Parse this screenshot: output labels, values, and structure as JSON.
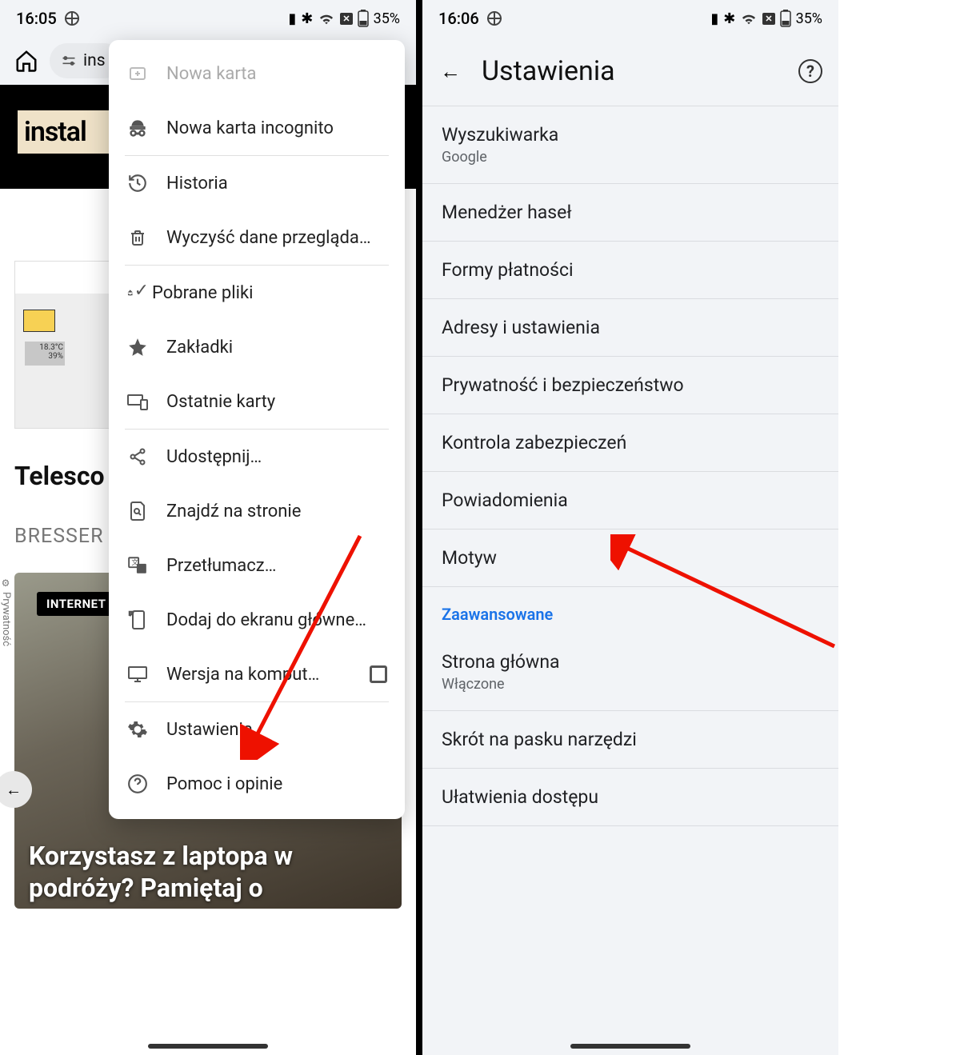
{
  "screen1": {
    "status": {
      "time": "16:05",
      "battery": "35%"
    },
    "address_text": "ins",
    "page": {
      "logo": "instal",
      "lcd_top": "18.3°C",
      "lcd_bot": "39%",
      "article_title": "Telesco",
      "brand": "BRESSER",
      "tag": "INTERNET",
      "headline": "Korzystasz z laptopa w podróży? Pamiętaj o",
      "priv_label": "Prywatność"
    },
    "menu": {
      "new_tab": "Nowa karta",
      "incognito": "Nowa karta incognito",
      "history": "Historia",
      "clear_data": "Wyczyść dane przegląda…",
      "downloads": "Pobrane pliki",
      "bookmarks": "Zakładki",
      "recent_tabs": "Ostatnie karty",
      "share": "Udostępnij…",
      "find": "Znajdź na stronie",
      "translate": "Przetłumacz…",
      "add_home": "Dodaj do ekranu głównego",
      "desktop": "Wersja na komput…",
      "settings": "Ustawienia",
      "help": "Pomoc i opinie"
    }
  },
  "screen2": {
    "status": {
      "time": "16:06",
      "battery": "35%"
    },
    "title": "Ustawienia",
    "rows": {
      "search_engine": "Wyszukiwarka",
      "search_engine_sub": "Google",
      "passwords": "Menedżer haseł",
      "payments": "Formy płatności",
      "addresses": "Adresy i ustawienia",
      "privacy": "Prywatność i bezpieczeństwo",
      "safety_check": "Kontrola zabezpieczeń",
      "notifications": "Powiadomienia",
      "theme": "Motyw",
      "section_advanced": "Zaawansowane",
      "homepage": "Strona główna",
      "homepage_sub": "Włączone",
      "toolbar_shortcut": "Skrót na pasku narzędzi",
      "accessibility": "Ułatwienia dostępu"
    }
  }
}
